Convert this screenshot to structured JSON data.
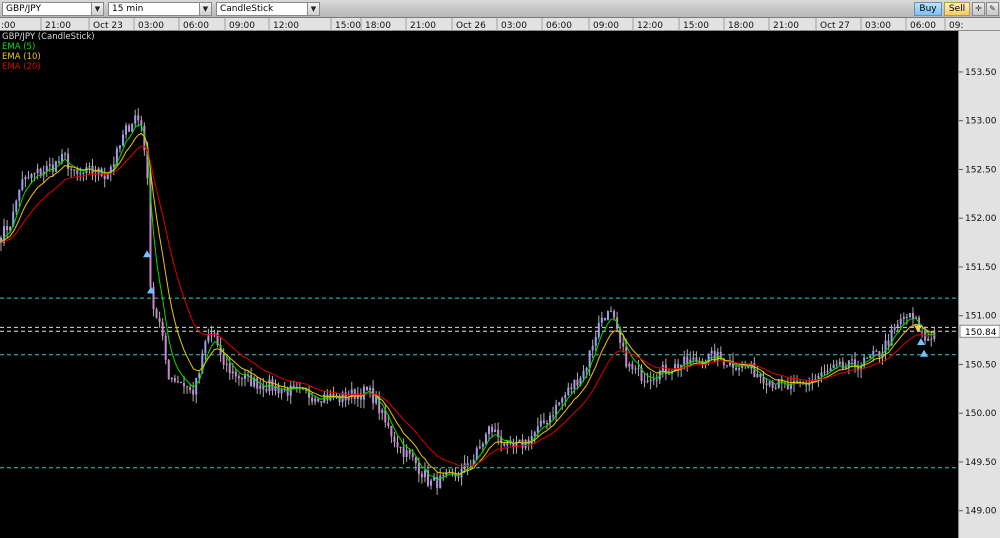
{
  "toolbar": {
    "symbol": "GBP/JPY",
    "timeframe": "15 min",
    "chart_style": "CandleStick",
    "buy_label": "Buy",
    "sell_label": "Sell",
    "tool_icon_1": "crosshair-icon",
    "tool_icon_2": "drawing-tools-icon"
  },
  "legend": {
    "title": "GBP/JPY (CandleStick)",
    "items": [
      {
        "label": "EMA (5)",
        "color": "#00dd00"
      },
      {
        "label": "EMA (10)",
        "color": "#e8c800"
      },
      {
        "label": "EMA (20)",
        "color": "#e00000"
      }
    ]
  },
  "colors": {
    "background": "#000000",
    "candle_up": "#9aa0ee",
    "candle_down": "#cc88cc",
    "wick": "#b0b0b0",
    "hline_cyan": "#3bc9c9",
    "hline_white": "#dcdcdc",
    "price_tag_bg": "#ffffff",
    "arrow_buy": "#6fc3ff",
    "arrow_sell": "#e8d060"
  },
  "chart_data": {
    "type": "candlestick",
    "symbol": "GBP/JPY",
    "interval": "15 min",
    "y_ticks": [
      "153.50",
      "153.00",
      "152.50",
      "152.00",
      "151.50",
      "151.00",
      "150.50",
      "150.00",
      "149.50",
      "149.00"
    ],
    "ylim": [
      148.72,
      153.92
    ],
    "x_ticks": [
      ":00",
      "21:00",
      "Oct 23",
      "03:00",
      "06:00",
      "09:00",
      "12:00",
      "15:00",
      "18:00",
      "21:00",
      "Oct 26",
      "03:00",
      "06:00",
      "09:00",
      "12:00",
      "15:00",
      "18:00",
      "21:00",
      "Oct 27",
      "03:00",
      "06:00",
      "09:"
    ],
    "current_price": "150.84",
    "horizontal_lines": [
      {
        "price": 151.18,
        "style": "dashed",
        "color": "cyan"
      },
      {
        "price": 150.88,
        "style": "dashed",
        "color": "white"
      },
      {
        "price": 150.84,
        "style": "dashed",
        "color": "white"
      },
      {
        "price": 150.6,
        "style": "dashed",
        "color": "cyan"
      },
      {
        "price": 149.44,
        "style": "dashed",
        "color": "cyan"
      }
    ],
    "close_path": [
      [
        0,
        151.8
      ],
      [
        12,
        151.98
      ],
      [
        20,
        152.35
      ],
      [
        35,
        152.45
      ],
      [
        55,
        152.55
      ],
      [
        65,
        152.62
      ],
      [
        75,
        152.42
      ],
      [
        90,
        152.48
      ],
      [
        105,
        152.45
      ],
      [
        115,
        152.6
      ],
      [
        125,
        152.88
      ],
      [
        135,
        153.05
      ],
      [
        142,
        152.95
      ],
      [
        147,
        152.5
      ],
      [
        150,
        151.4
      ],
      [
        153,
        151.1
      ],
      [
        160,
        150.9
      ],
      [
        168,
        150.4
      ],
      [
        176,
        150.35
      ],
      [
        184,
        150.3
      ],
      [
        192,
        150.2
      ],
      [
        198,
        150.35
      ],
      [
        206,
        150.75
      ],
      [
        214,
        150.85
      ],
      [
        220,
        150.55
      ],
      [
        232,
        150.42
      ],
      [
        245,
        150.35
      ],
      [
        260,
        150.3
      ],
      [
        280,
        150.25
      ],
      [
        300,
        150.2
      ],
      [
        320,
        150.18
      ],
      [
        340,
        150.15
      ],
      [
        355,
        150.2
      ],
      [
        368,
        150.22
      ],
      [
        375,
        150.15
      ],
      [
        385,
        149.9
      ],
      [
        400,
        149.65
      ],
      [
        415,
        149.5
      ],
      [
        430,
        149.28
      ],
      [
        445,
        149.32
      ],
      [
        460,
        149.38
      ],
      [
        475,
        149.55
      ],
      [
        490,
        149.85
      ],
      [
        500,
        149.75
      ],
      [
        510,
        149.62
      ],
      [
        525,
        149.7
      ],
      [
        540,
        149.85
      ],
      [
        555,
        150.05
      ],
      [
        570,
        150.25
      ],
      [
        585,
        150.45
      ],
      [
        595,
        150.8
      ],
      [
        603,
        151.02
      ],
      [
        612,
        151.0
      ],
      [
        620,
        150.7
      ],
      [
        630,
        150.45
      ],
      [
        645,
        150.38
      ],
      [
        660,
        150.42
      ],
      [
        680,
        150.5
      ],
      [
        700,
        150.55
      ],
      [
        715,
        150.58
      ],
      [
        730,
        150.52
      ],
      [
        745,
        150.48
      ],
      [
        760,
        150.4
      ],
      [
        775,
        150.3
      ],
      [
        790,
        150.25
      ],
      [
        805,
        150.3
      ],
      [
        820,
        150.38
      ],
      [
        835,
        150.45
      ],
      [
        850,
        150.48
      ],
      [
        865,
        150.52
      ],
      [
        880,
        150.62
      ],
      [
        895,
        150.85
      ],
      [
        905,
        151.0
      ],
      [
        915,
        150.95
      ],
      [
        925,
        150.75
      ],
      [
        935,
        150.84
      ]
    ],
    "ema_offsets": {
      "EMA (5)": 0,
      "EMA (10)": 1,
      "EMA (20)": 2
    },
    "signals": [
      {
        "x": 147,
        "price": 151.62,
        "type": "buy"
      },
      {
        "x": 151,
        "price": 151.25,
        "type": "buy"
      },
      {
        "x": 918,
        "price": 150.88,
        "type": "sell"
      },
      {
        "x": 921,
        "price": 150.72,
        "type": "buy"
      },
      {
        "x": 924,
        "price": 150.6,
        "type": "buy"
      }
    ]
  }
}
